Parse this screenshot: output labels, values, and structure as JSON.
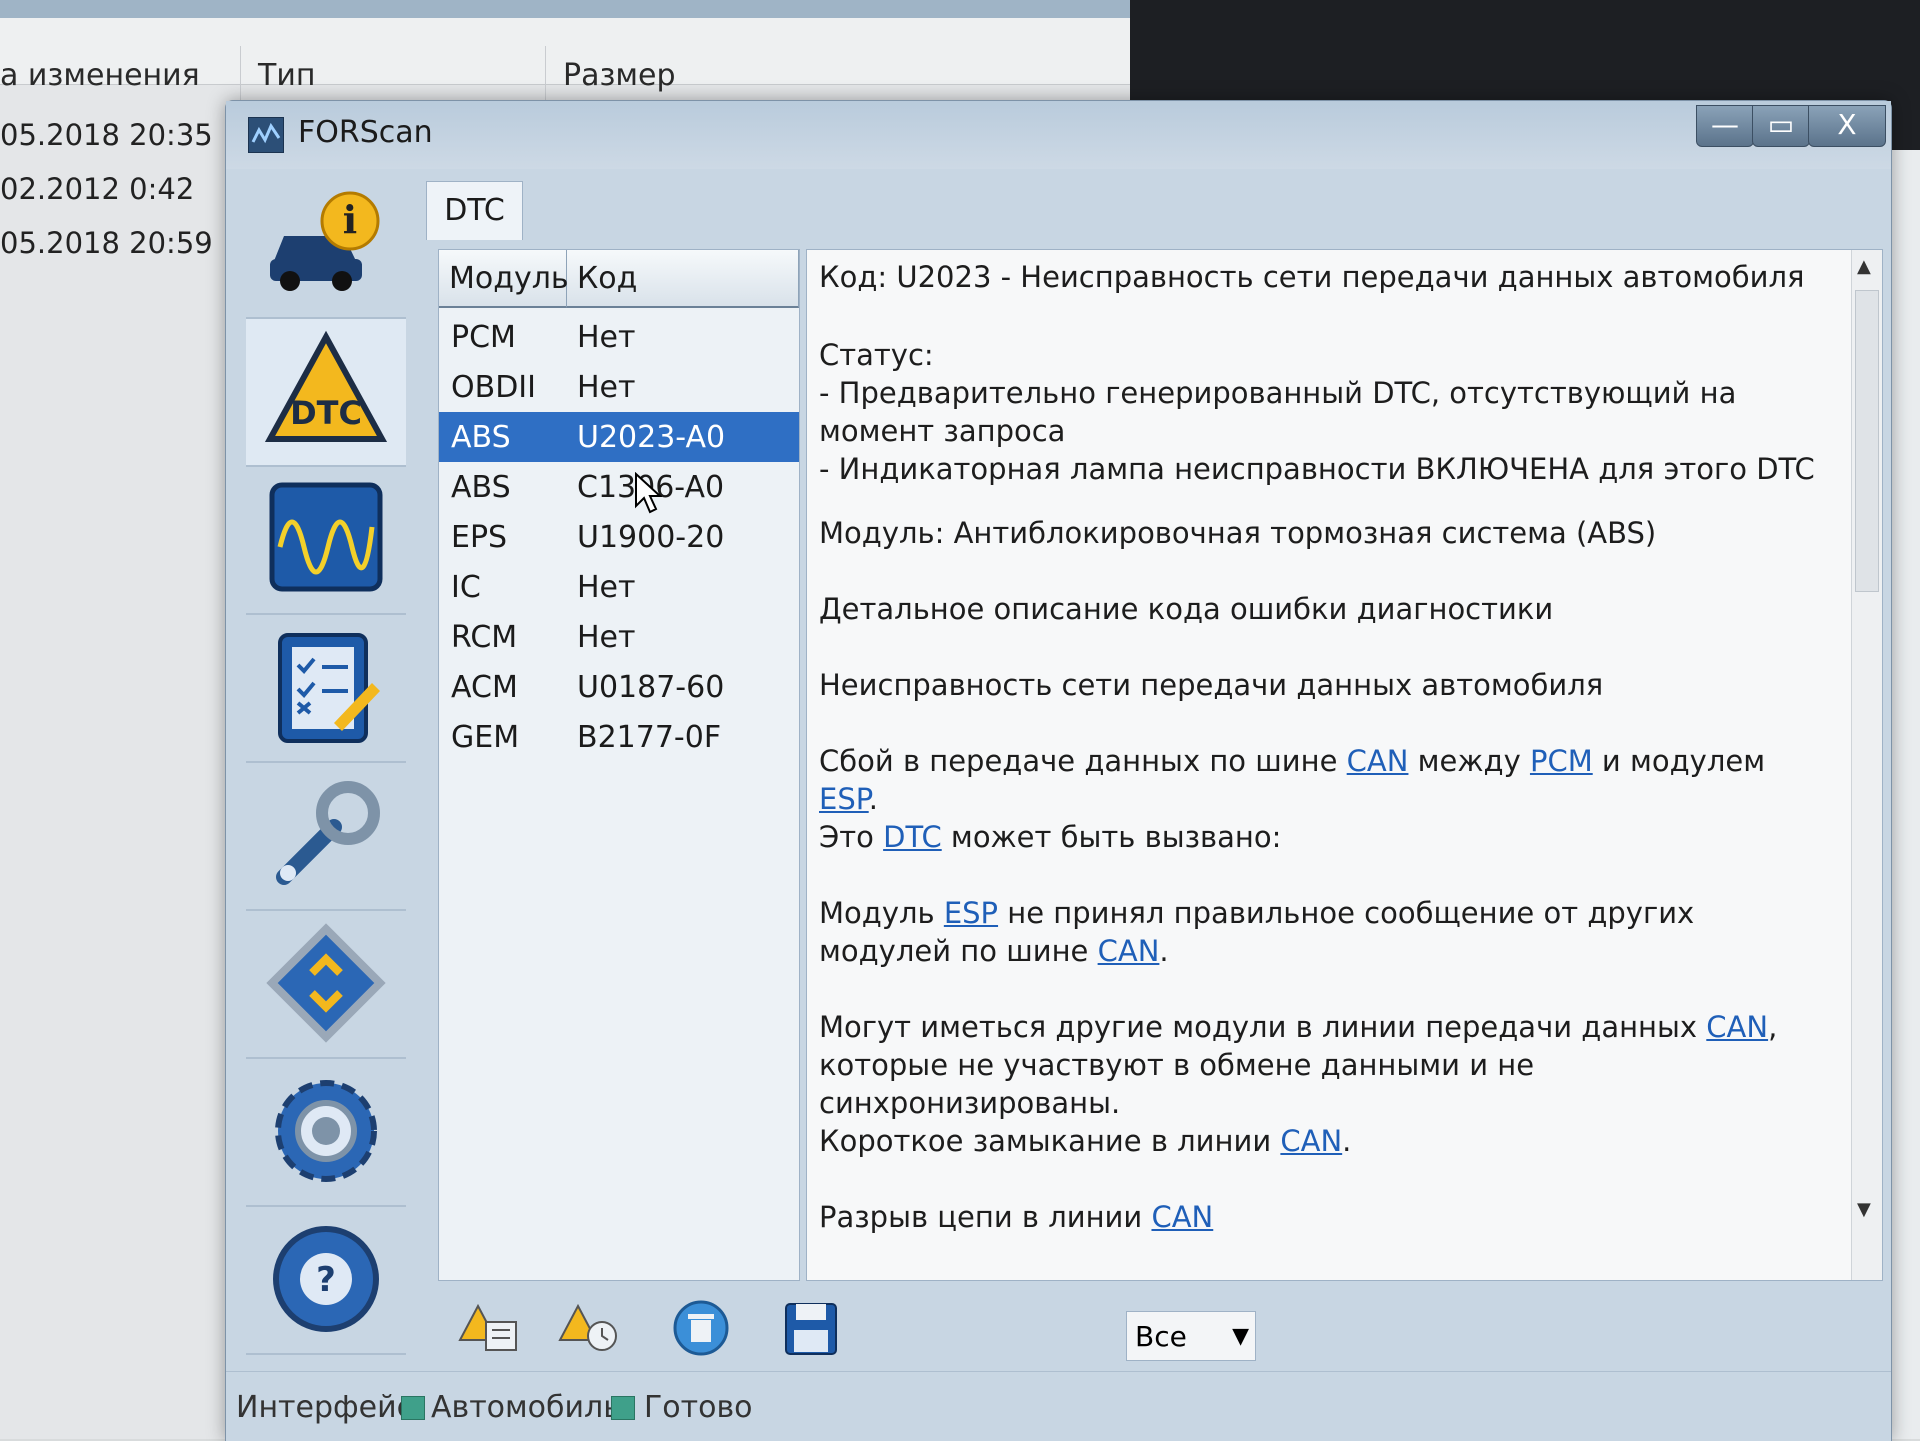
{
  "background_explorer": {
    "columns": [
      "а изменения",
      "Тип",
      "Размер"
    ],
    "rows": [
      "05.2018 20:35",
      "02.2012 0:42",
      "05.2018 20:59"
    ]
  },
  "window": {
    "title": "FORScan",
    "controls": {
      "minimize": "—",
      "maximize": "▭",
      "close": "X"
    }
  },
  "sidebar": {
    "items": [
      {
        "icon": "car-info-icon"
      },
      {
        "icon": "dtc-warning-icon"
      },
      {
        "icon": "oscilloscope-icon"
      },
      {
        "icon": "checklist-icon"
      },
      {
        "icon": "wrench-icon"
      },
      {
        "icon": "chip-icon"
      },
      {
        "icon": "gear-icon"
      },
      {
        "icon": "help-steering-icon"
      }
    ]
  },
  "tabs": {
    "active": "DTC"
  },
  "module_list": {
    "headers": [
      "Модуль",
      "Код"
    ],
    "rows": [
      {
        "module": "PCM",
        "code": "Нет"
      },
      {
        "module": "OBDII",
        "code": "Нет"
      },
      {
        "module": "ABS",
        "code": "U2023-A0",
        "selected": true
      },
      {
        "module": "ABS",
        "code": "C1306-A0"
      },
      {
        "module": "EPS",
        "code": "U1900-20"
      },
      {
        "module": "IC",
        "code": "Нет"
      },
      {
        "module": "RCM",
        "code": "Нет"
      },
      {
        "module": "ACM",
        "code": "U0187-60"
      },
      {
        "module": "GEM",
        "code": "B2177-0F"
      }
    ]
  },
  "details": {
    "code_line": "Код: U2023 - Неисправность сети передачи данных автомобиля",
    "status_label": "Статус:",
    "status_1": " - Предварительно генерированный DTC, отсутствующий на момент запроса",
    "status_2": " - Индикаторная лампа неисправности ВКЛЮЧЕНА для этого DTC",
    "module_line": "Модуль: Антиблокировочная тормозная система (ABS)",
    "desc_heading": "Детальное описание кода ошибки диагностики",
    "desc_title": "Неисправность сети передачи данных автомобиля",
    "p1": {
      "a": "Сбой в передаче данных по шине ",
      "l1": "CAN",
      "b": " между ",
      "l2": "PCM",
      "c": " и модулем ",
      "l3": "ESP",
      "d": "."
    },
    "p2": {
      "a": "Это ",
      "l1": "DTC",
      "b": " может быть вызвано:"
    },
    "p3": {
      "a": "Модуль ",
      "l1": "ESP",
      "b": " не принял правильное сообщение от других модулей по шине ",
      "l2": "CAN",
      "c": "."
    },
    "p4": {
      "a": "Могут иметься другие модули в линии передачи данных ",
      "l1": "CAN",
      "b": ", которые не участвуют в обмене данными и не синхронизированы."
    },
    "p5": {
      "a": "Короткое замыкание в линии ",
      "l1": "CAN",
      "b": "."
    },
    "p6": {
      "a": "Разрыв цепи в линии ",
      "l1": "CAN"
    }
  },
  "toolbar": {
    "filter_value": "Все"
  },
  "statusbar": {
    "interface_label": "Интерфейс:",
    "vehicle_label": "Автомобиль:",
    "state_label": "Готово"
  }
}
